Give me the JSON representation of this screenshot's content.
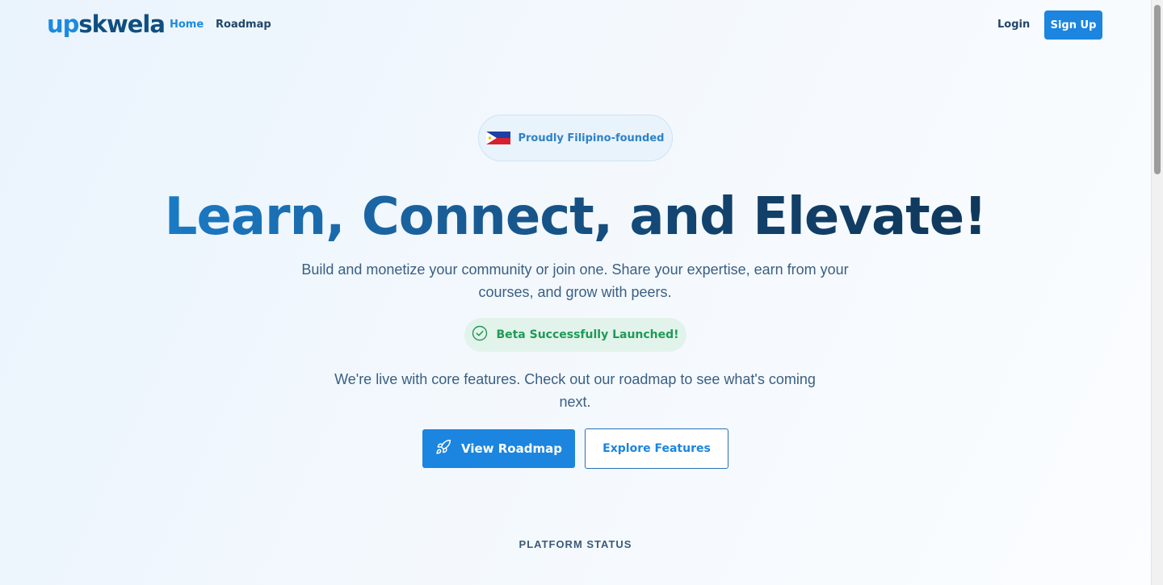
{
  "nav": {
    "logo_up": "up",
    "logo_rest": "skwela",
    "home": "Home",
    "roadmap": "Roadmap",
    "login": "Login",
    "signup": "Sign Up"
  },
  "hero": {
    "badge": "Proudly Filipino-founded",
    "headline": "Learn, Connect, and Elevate!",
    "subtitle": "Build and monetize your community or join one. Share your expertise, earn from your courses, and grow with peers.",
    "beta": "Beta Successfully Launched!",
    "live": "We're live with core features. Check out our roadmap to see what's coming next.",
    "primary_button": "View Roadmap",
    "secondary_button": "Explore Features"
  },
  "status": {
    "label": "PLATFORM STATUS"
  },
  "colors": {
    "brand": "#1b85e0",
    "success": "#1f9a55",
    "dark": "#0f4f80"
  }
}
